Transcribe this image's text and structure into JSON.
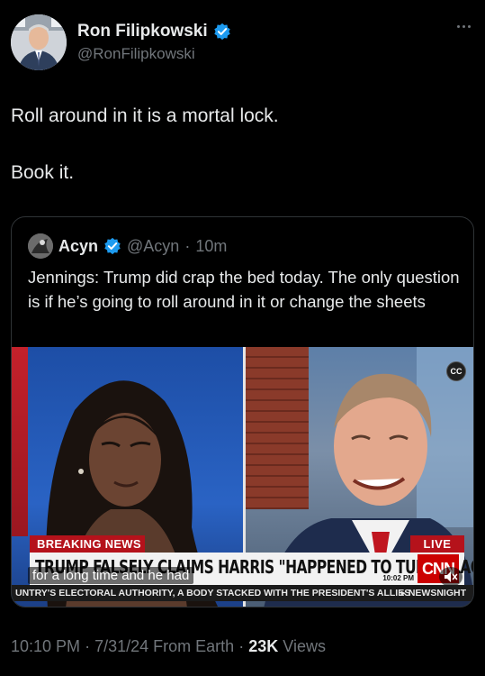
{
  "author": {
    "display_name": "Ron Filipkowski",
    "handle": "@RonFilipkowski",
    "verified_icon": "verified-badge-icon",
    "accent": "#1d9bf0"
  },
  "tweet": {
    "lines": [
      "Roll around in it is a mortal lock.",
      "Book it."
    ]
  },
  "quoted": {
    "display_name": "Acyn",
    "handle": "@Acyn",
    "separator": "·",
    "age": "10m",
    "text": "Jennings: Trump did crap the bed today. The only question is if he’s going to roll around in it or change the sheets",
    "video": {
      "breaking_label": "BREAKING NEWS",
      "live_label": "LIVE",
      "headline": "TRUMP FALSELY CLAIMS HARRIS \"HAPPENED TO TURN BLACK\"",
      "network": "CNN",
      "clock": "10:02 PM",
      "caption": "for a long time and he had",
      "ticker": "UNTRY'S ELECTORAL AUTHORITY, A BODY STACKED WITH THE PRESIDENT'S ALLIES",
      "ticker_right": "NEWSNIGHT",
      "cc_label": "CC"
    }
  },
  "meta": {
    "time": "10:10 PM",
    "sep1": "·",
    "date": "7/31/24",
    "source": "From Earth",
    "sep2": "·",
    "views_count": "23K",
    "views_label": "Views"
  },
  "colors": {
    "background": "#000000",
    "text": "#e7e9ea",
    "secondary": "#71767b",
    "border": "#2f3336",
    "cnn_red": "#cc0000"
  }
}
